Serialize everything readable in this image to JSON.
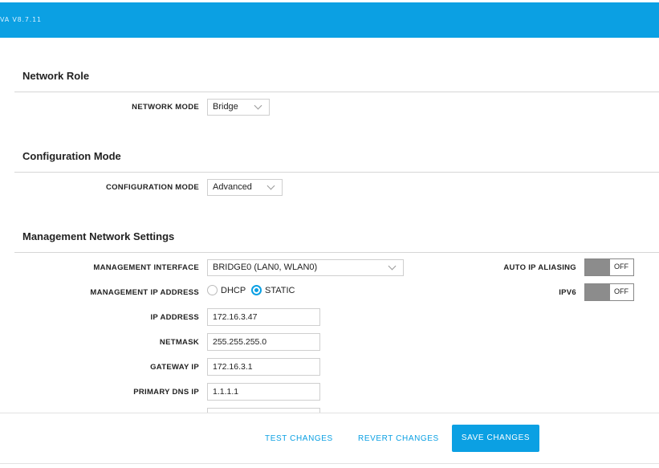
{
  "header": {
    "version": "VA V8.7.11"
  },
  "network_role": {
    "title": "Network Role",
    "network_mode_label": "NETWORK MODE",
    "network_mode_value": "Bridge"
  },
  "configuration_mode": {
    "title": "Configuration Mode",
    "configuration_mode_label": "CONFIGURATION MODE",
    "configuration_mode_value": "Advanced"
  },
  "management": {
    "title": "Management Network Settings",
    "interface_label": "MANAGEMENT INTERFACE",
    "interface_value": "BRIDGE0 (LAN0, WLAN0)",
    "ip_address_mode_label": "MANAGEMENT IP ADDRESS",
    "ip_mode_options": [
      "DHCP",
      "STATIC"
    ],
    "ip_mode_selected": "STATIC",
    "ip_address_label": "IP ADDRESS",
    "ip_address_value": "172.16.3.47",
    "netmask_label": "NETMASK",
    "netmask_value": "255.255.255.0",
    "gateway_label": "GATEWAY IP",
    "gateway_value": "172.16.3.1",
    "primary_dns_label": "PRIMARY DNS IP",
    "primary_dns_value": "1.1.1.1",
    "auto_ip_aliasing_label": "AUTO IP ALIASING",
    "auto_ip_aliasing_state": "OFF",
    "ipv6_label": "IPV6",
    "ipv6_state": "OFF"
  },
  "footer": {
    "test_label": "TEST CHANGES",
    "revert_label": "REVERT CHANGES",
    "save_label": "SAVE CHANGES"
  },
  "colors": {
    "accent": "#0ba0e3",
    "toggle_off": "#8c8c8c"
  }
}
